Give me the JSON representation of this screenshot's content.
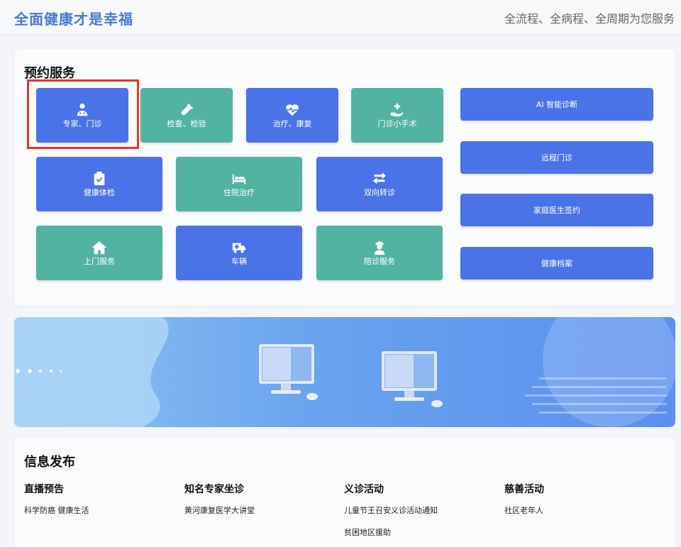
{
  "header": {
    "brand": "全面健康才是幸福",
    "slogan": "全流程、全病程、全周期为您服务"
  },
  "booking": {
    "title": "预约服务",
    "tiles": [
      {
        "label": "专家、门诊",
        "icon": "doctor-icon",
        "color": "#4b73e8"
      },
      {
        "label": "检查、检验",
        "icon": "test-tube-icon",
        "color": "#53b3a3"
      },
      {
        "label": "治疗、康复",
        "icon": "heartbeat-icon",
        "color": "#4b73e8"
      },
      {
        "label": "门诊小手术",
        "icon": "hand-plus-icon",
        "color": "#53b3a3"
      },
      {
        "label": "健康体检",
        "icon": "clipboard-check-icon",
        "color": "#4b73e8"
      },
      {
        "label": "住院治疗",
        "icon": "hospital-bed-icon",
        "color": "#53b3a3"
      },
      {
        "label": "双向转诊",
        "icon": "transfer-arrows-icon",
        "color": "#4b73e8"
      },
      {
        "label": "上门服务",
        "icon": "home-icon",
        "color": "#53b3a3"
      },
      {
        "label": "车辆",
        "icon": "ambulance-icon",
        "color": "#4b73e8"
      },
      {
        "label": "陪诊服务",
        "icon": "nurse-icon",
        "color": "#53b3a3"
      }
    ],
    "side_buttons": [
      {
        "label": "AI 智能诊断"
      },
      {
        "label": "远程门诊"
      },
      {
        "label": "家庭医生签约"
      },
      {
        "label": "健康档案"
      }
    ],
    "highlight_color": "#e8332b"
  },
  "banner": {
    "dots": 5
  },
  "info": {
    "title": "信息发布",
    "columns": [
      {
        "heading": "直播预告",
        "items": [
          "科学防癌 健康生活"
        ]
      },
      {
        "heading": "知名专家坐诊",
        "items": [
          "黄河康复医学大讲堂"
        ]
      },
      {
        "heading": "义诊活动",
        "items": [
          "儿童节王召安义诊活动通知",
          "贫困地区援助"
        ]
      },
      {
        "heading": "慈善活动",
        "items": [
          "社区老年人"
        ]
      }
    ]
  }
}
